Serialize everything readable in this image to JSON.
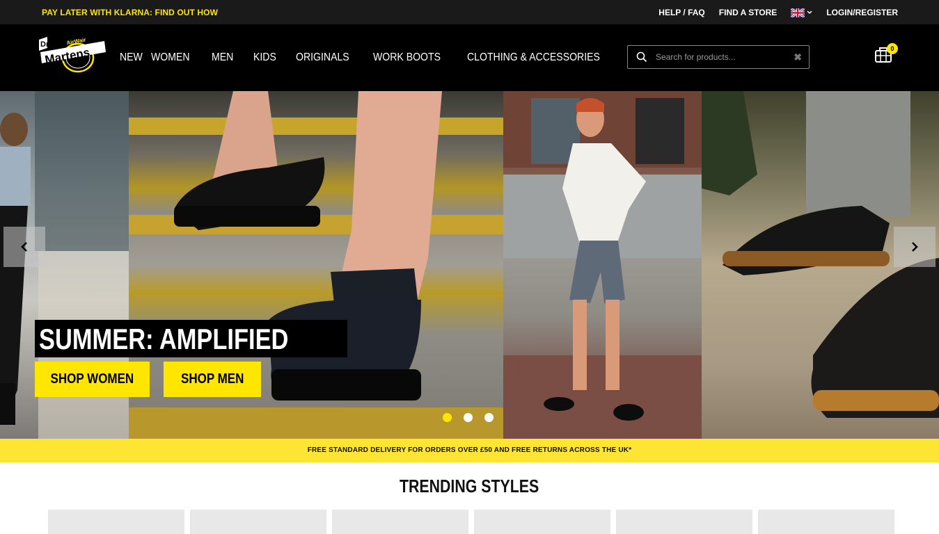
{
  "utility": {
    "promo": "PAY LATER WITH KLARNA: FIND OUT HOW",
    "help": "HELP / FAQ",
    "find_store": "FIND A STORE",
    "login": "LOGIN/REGISTER"
  },
  "brand": {
    "logo_text": "Dr. Martens",
    "logo_sub": "AirWair"
  },
  "nav": [
    "NEW",
    "WOMEN",
    "MEN",
    "KIDS",
    "ORIGINALS",
    "WORK BOOTS",
    "CLOTHING & ACCESSORIES"
  ],
  "search": {
    "placeholder": "Search for products...",
    "clear": "✖"
  },
  "basket": {
    "count": "0"
  },
  "hero": {
    "title": "SUMMER: AMPLIFIED",
    "cta_women": "SHOP WOMEN",
    "cta_men": "SHOP MEN",
    "slides": 3,
    "active_slide": 1
  },
  "delivery": "FREE STANDARD DELIVERY FOR ORDERS OVER £50 AND FREE RETURNS ACROSS THE UK*",
  "trending": {
    "title": "TRENDING STYLES",
    "tiles": 6
  },
  "colors": {
    "accent": "#ffe600",
    "header_bg": "#000000",
    "utility_bg": "#1a1a1a"
  }
}
